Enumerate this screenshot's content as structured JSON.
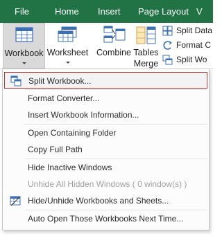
{
  "tabs": [
    "File",
    "Home",
    "Insert",
    "Page Layout",
    "V"
  ],
  "ribbon": {
    "workbook_label": "Workbook",
    "worksheet_label": "Worksheet",
    "combine_label": "Combine",
    "tables_label_1": "Tables",
    "tables_label_2": "Merge",
    "small_buttons": [
      "Split Data",
      "Format C",
      "Split Wo"
    ]
  },
  "menu": {
    "items": [
      "Split Workbook...",
      "Format Converter...",
      "Insert Workbook Information...",
      "Open Containing Folder",
      "Copy Full Path",
      "Hide Inactive Windows",
      "Unhide All Hidden Windows ( 0 window(s) )",
      "Hide/Unhide Workbooks and Sheets...",
      "Auto Open Those Workbooks Next Time..."
    ]
  },
  "colors": {
    "ribbon_green": "#217346",
    "selected_border": "#b43a3a"
  }
}
